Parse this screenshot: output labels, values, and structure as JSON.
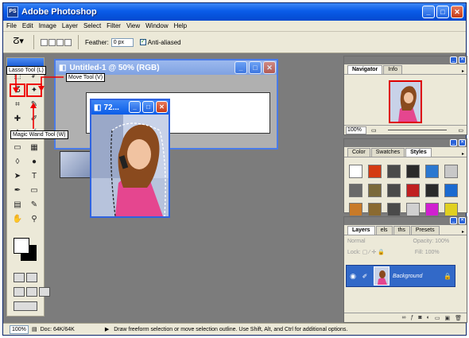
{
  "app": {
    "title": "Adobe Photoshop",
    "logo": "PS"
  },
  "menu": [
    "File",
    "Edit",
    "Image",
    "Layer",
    "Select",
    "Filter",
    "View",
    "Window",
    "Help"
  ],
  "options": {
    "feather_label": "Feather:",
    "feather_value": "0 px",
    "anti_alias_label": "Anti-aliased",
    "anti_alias_checked": true
  },
  "callouts": {
    "lasso": "Lasso Tool (L)",
    "move": "Move Tool (V)",
    "magic_wand": "Magic Wand Tool (W)"
  },
  "document": {
    "title": "Untitled-1 @ 50% (RGB)"
  },
  "image_window": {
    "title": "72..."
  },
  "navigator": {
    "tabs": [
      "Navigator",
      "Info"
    ],
    "zoom": "100%"
  },
  "swatches": {
    "tabs": [
      "Color",
      "Swatches",
      "Styles"
    ],
    "colors": [
      "#ffffff",
      "#d43a12",
      "#4a4a4a",
      "#2a2a2a",
      "#2b78d0",
      "#c8c8c8",
      "#6a6a6a",
      "#7b6a3a",
      "#4a4a4a",
      "#c02020",
      "#2a2a2a",
      "#1a6ad0",
      "#c87a28",
      "#8a6a30",
      "#4a4a4a",
      "#d0d0d0",
      "#d020d0",
      "#e0d020"
    ]
  },
  "layers": {
    "tabs": [
      "Layers",
      "els",
      "ths",
      "Presets"
    ],
    "blend_mode": "Normal",
    "opacity_label": "Opacity:",
    "opacity_value": "100%",
    "lock_label": "Lock:",
    "fill_label": "Fill:",
    "fill_value": "100%",
    "layer_name": "Background"
  },
  "status": {
    "zoom": "100%",
    "doc": "Doc: 64K/64K",
    "hint": "Draw freeform selection or move selection outline. Use Shift, Alt, and Ctrl for additional options."
  }
}
